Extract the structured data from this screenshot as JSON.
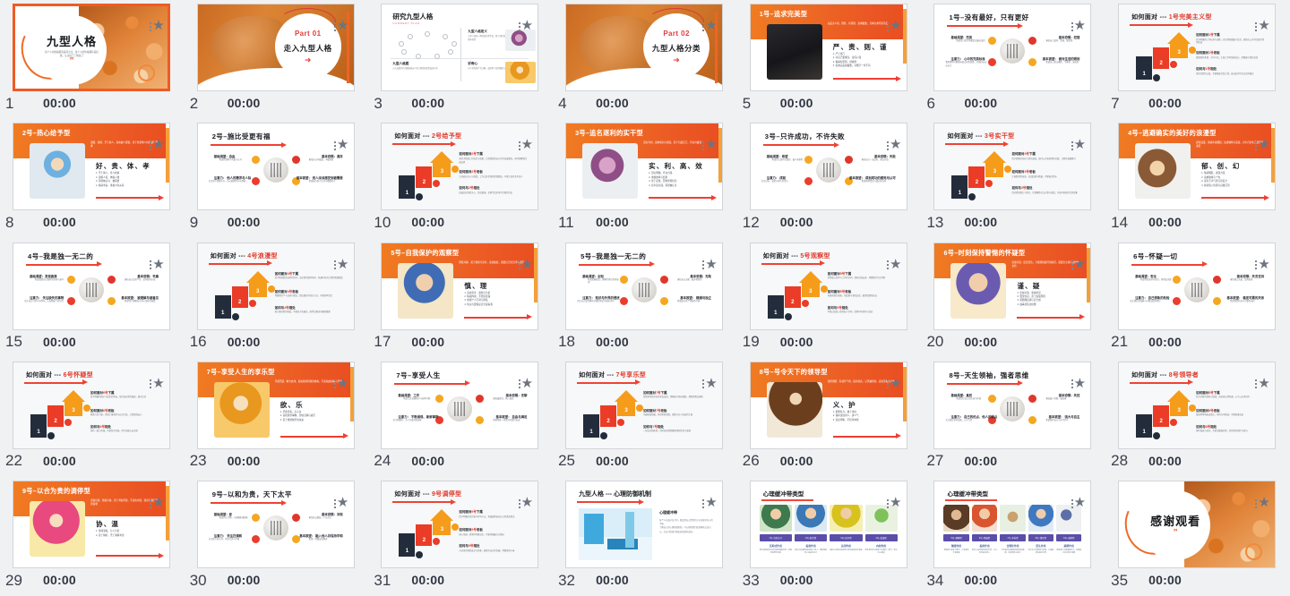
{
  "app": {
    "view": "slide-thumbnail-grid",
    "columns": 7,
    "rows": 5,
    "total_slides": 35,
    "selected_slide": 1,
    "accent_color": "#ef5b25",
    "background_color": "#f0f1f3",
    "star_icon": "star-icon",
    "default_time": "00:00"
  },
  "slides": [
    {
      "num": "1",
      "time": "00:00",
      "layout": "cover",
      "title": "九型人格",
      "subtitle": "每个人的性格都有其闪光点，每个人的性格都有其短板，认识自己了解自己",
      "quote": "”",
      "selected": true
    },
    {
      "num": "2",
      "time": "00:00",
      "layout": "part",
      "part_label": "Part 01",
      "title": "走入九型人格",
      "arrow": "➜"
    },
    {
      "num": "3",
      "time": "00:00",
      "layout": "overview",
      "title": "研究九型人格",
      "subtitle": "CURRENT PLAN",
      "blocks": [
        {
          "heading": "九型人格定义",
          "text": "九型人格是一种性格分类学说，把人的性格分为九种基本类型"
        },
        {
          "heading": "好奇心",
          "text": "对人的性格产生兴趣，去探索人性的奥秘与规律"
        },
        {
          "heading": "九型人格图",
          "text": "以九边形的几何图形表达人的九种性格类型及其关系"
        }
      ]
    },
    {
      "num": "4",
      "time": "00:00",
      "layout": "part",
      "part_label": "Part 02",
      "title": "九型人格分类",
      "arrow": "➜"
    },
    {
      "num": "5",
      "time": "00:00",
      "layout": "orange-header",
      "title": "1号–追求完美型",
      "header_desc": "完美主义者，理性、有原则、追求极致，凡事力求尽善尽美",
      "keywords": "严、责、则、谨",
      "lines": "1. 严于律己\n2. 对自己要求高，责任心强\n3. 做事有原则，讲规则\n4. 追求完美和极致，对细节一丝不苟",
      "photo": "ph-steve"
    },
    {
      "num": "6",
      "time": "00:00",
      "layout": "radial",
      "title": "1号–没有最好，只有更好",
      "nodes": [
        {
          "label": "基础渴望：完美",
          "text": "希望自己和世界都是正确无误的"
        },
        {
          "label": "注意力：\n心中的完美标准",
          "text": "看到事物与理想标准之间的差距，并想办法去纠正它"
        },
        {
          "label": "基本恐惧：犯错",
          "text": "害怕自己变坏、堕落、做错事"
        },
        {
          "label": "基本欲望：\n做对生活的规则",
          "text": "希望自己是正确的、平衡的、诚实的"
        }
      ]
    },
    {
      "num": "7",
      "time": "00:00",
      "layout": "stair",
      "title": "如何面对 --- ",
      "title_hl": "1号完美主义型",
      "steps": [
        {
          "n": "3",
          "heading": "如何面对",
          "heading_hl": "1号",
          "heading_tail": "下属",
          "text": "给予明确的工作标准与流程，肯定他的细致与负责，避免在公开场合批评他的错误"
        },
        {
          "n": "2",
          "heading": "如何面对",
          "heading_hl": "1号",
          "heading_tail": "老板",
          "text": "做事要有条理、守时守信，汇报工作时准备充分，用数据与事实说话"
        },
        {
          "n": "1",
          "heading": "如何与",
          "heading_hl": "1号",
          "heading_tail": "相处",
          "text": "多欣赏他的认真，不要随意打乱计划，表达批评时先肯定再建议"
        }
      ]
    },
    {
      "num": "8",
      "time": "00:00",
      "layout": "orange-header",
      "title": "2号–热心给予型",
      "header_desc": "温暖、热情、乐于助人，喜欢被人需要，善于察觉他人的情绪与需求",
      "keywords": "好、贵、体、孝",
      "lines": "1. 乐于助人，待人热情\n2. 善解人意，体贴入微\n3. 渴望被认可、被需要\n4. 情感丰富，重视人际关系",
      "photo": "ph-kid"
    },
    {
      "num": "9",
      "time": "00:00",
      "layout": "radial",
      "title": "2号–施比受更有福",
      "nodes": [
        {
          "label": "基础渴望：自由",
          "text": "希望得到他人的爱与认可"
        },
        {
          "label": "注意力：\n他人的需求与人际",
          "text": "关注别人需要什么，自己能提供什么帮助"
        },
        {
          "label": "基本恐惧：漠弃",
          "text": "害怕自己不被爱、不被需要"
        },
        {
          "label": "基本欲望：\n别人深深感受到被需要",
          "text": "希望成为别人生命中重要的人"
        }
      ]
    },
    {
      "num": "10",
      "time": "00:00",
      "layout": "stair",
      "title": "如何面对 --- ",
      "title_hl": "2号给予型",
      "steps": [
        {
          "n": "3",
          "heading": "如何面对",
          "heading_hl": "2号",
          "heading_tail": "下属",
          "text": "多给予情感上的肯定与感谢，让他感受到自己的付出被看见，同时提醒他注意边界"
        },
        {
          "n": "2",
          "heading": "如何面对",
          "heading_hl": "2号",
          "heading_tail": "老板",
          "text": "主动表达关心与感激，工作之外也保持情感联结，不要只谈任务不谈人"
        },
        {
          "n": "1",
          "heading": "如何与",
          "heading_hl": "2号",
          "heading_tail": "相处",
          "text": "真诚回应他的关心，常说谢谢，也要学会拒绝不合理的付出"
        }
      ]
    },
    {
      "num": "11",
      "time": "00:00",
      "layout": "orange-header",
      "title": "3号–追名逐利的实干型",
      "header_desc": "目标导向，追求成功与成就，善于包装自己，行动力极强",
      "keywords": "实、利、高、效",
      "lines": "1. 目标明确，行动力强\n2. 重视效率与结果\n3. 善于表现，形象管理出色\n4. 竞争意识强，渴望被认可",
      "photo": "ph-doer"
    },
    {
      "num": "12",
      "time": "00:00",
      "layout": "radial",
      "title": "3号–只许成功，不许失败",
      "nodes": [
        {
          "label": "基础渴望：希望",
          "text": "希望自己是有价值的、被人羡慕的"
        },
        {
          "label": "注意力：\n成就",
          "text": "关注目标、业绩与他人的评价"
        },
        {
          "label": "基本恐惧：失败",
          "text": "害怕自己一无是处、毫无价值"
        },
        {
          "label": "基本欲望：\n得到成功的感觉与认可",
          "text": "希望获得赞赏与成功的光环"
        }
      ]
    },
    {
      "num": "13",
      "time": "00:00",
      "layout": "stair",
      "title": "如何面对 --- ",
      "title_hl": "3号实干型",
      "steps": [
        {
          "n": "3",
          "heading": "如何面对",
          "heading_hl": "3号",
          "heading_tail": "下属",
          "text": "给予清晰的目标与晋升通道，及时公开表扬他的业绩，让他有施展舞台"
        },
        {
          "n": "2",
          "heading": "如何面对",
          "heading_hl": "3号",
          "heading_tail": "老板",
          "text": "汇报要简明高效，突出结果与数据，不要拖泥带水"
        },
        {
          "n": "1",
          "heading": "如何与",
          "heading_hl": "3号",
          "heading_tail": "相处",
          "text": "欣赏他的能力与努力，也提醒他关注过程与感受，不必时刻保持完美形象"
        }
      ]
    },
    {
      "num": "14",
      "time": "00:00",
      "layout": "orange-header",
      "title": "4号–逃避确实的美好的浪漫型",
      "header_desc": "感性浪漫，情感丰富细腻，追求独特与深度，对平凡的生活感到不满足",
      "keywords": "郁、创、幻",
      "lines": "1. 情感细腻，感受力强\n2. 追求独特与个性\n3. 富有艺术气质与创造力\n4. 容易陷入忧郁与自我沉溺",
      "photo": "ph-rom"
    },
    {
      "num": "15",
      "time": "00:00",
      "layout": "radial",
      "title": "4号–我是独一无二的",
      "nodes": [
        {
          "label": "基础渴望：发现真我",
          "text": "希望找到自己独特的身份与意义"
        },
        {
          "label": "注意力：\n关注缺失的事物",
          "text": "关注自己与别人的不同，以及所缺少的东西"
        },
        {
          "label": "基本恐惧：平庸",
          "text": "害怕自己没有个性、没有独特价值"
        },
        {
          "label": "基本欲望：\n被理解与被看见",
          "text": "希望别人理解自己内心深处的感受"
        }
      ]
    },
    {
      "num": "16",
      "time": "00:00",
      "layout": "stair",
      "title": "如何面对 --- ",
      "title_hl": "4号浪漫型",
      "steps": [
        {
          "n": "3",
          "heading": "如何面对",
          "heading_hl": "4号",
          "heading_tail": "下属",
          "text": "给予他创造性发挥的空间，肯定他的独特审美，沟通时多关注他的情绪感受"
        },
        {
          "n": "2",
          "heading": "如何面对",
          "heading_hl": "4号",
          "heading_tail": "老板",
          "text": "尊重他的个人品味与想法，提出建议时讲究方式，不要简单否定"
        },
        {
          "n": "1",
          "heading": "如何与",
          "heading_hl": "4号",
          "heading_tail": "相处",
          "text": "耐心倾听他的感受，不要急于给建议，陪伴比解决问题更重要"
        }
      ]
    },
    {
      "num": "17",
      "time": "00:00",
      "layout": "orange-header",
      "title": "5号–自我保护的观察型",
      "header_desc": "理性冷静、善于观察与思考，喜欢独处，需要自己的空间与能量",
      "keywords": "慎、理",
      "lines": "1. 喜欢思考、观察与分析\n2. 情感内敛，不轻易表露\n3. 重视个人空间与隐私\n4. 知识与逻辑是安全感来源",
      "photo": "ph-obs"
    },
    {
      "num": "18",
      "time": "00:00",
      "layout": "radial",
      "title": "5号–我是独一无二的",
      "nodes": [
        {
          "label": "基础渴望：全知",
          "text": "希望掌握知识，理解世界运作的规律"
        },
        {
          "label": "注意力：\n知识与外界的侵扰",
          "text": "关注自己是否拥有足够的知识与独处空间"
        },
        {
          "label": "基本恐惧：无助",
          "text": "害怕自己无能、被外界掏空"
        },
        {
          "label": "基本欲望：\n精通与独立",
          "text": "希望成为某个领域的专家"
        }
      ]
    },
    {
      "num": "19",
      "time": "00:00",
      "layout": "stair",
      "title": "如何面对 --- ",
      "title_hl": "5号观察型",
      "steps": [
        {
          "n": "3",
          "heading": "如何面对",
          "heading_hl": "5号",
          "heading_tail": "下属",
          "text": "给他独立思考与工作的空间，提前告知安排，尊重他的专业判断"
        },
        {
          "n": "2",
          "heading": "如何面对",
          "heading_hl": "5号",
          "heading_tail": "老板",
          "text": "沟通前做足准备，用逻辑与事实说话，避免情绪化表达"
        },
        {
          "n": "1",
          "heading": "如何与",
          "heading_hl": "5号",
          "heading_tail": "相处",
          "text": "不要过度侵入他的私人空间，给他时间消化与回应"
        }
      ]
    },
    {
      "num": "20",
      "time": "00:00",
      "layout": "orange-header",
      "title": "6号–时刻保持警惕的怀疑型",
      "header_desc": "忠诚可靠、居安思危，习惯预想最坏的情况，需要安全感与团体的支持",
      "keywords": "谨、疑",
      "lines": "1. 忠诚可靠，重视承诺\n2. 警觉性高，善于发现风险\n3. 需要确定感与安全感\n4. 遇事易焦虑犹豫",
      "photo": "ph-doubt"
    },
    {
      "num": "21",
      "time": "00:00",
      "layout": "radial",
      "title": "6号–怀疑一切",
      "nodes": [
        {
          "label": "基础渴望：安全",
          "text": "希望得到支持与指引，获得安全感"
        },
        {
          "label": "注意力：\n自己想象的危险",
          "text": "关注潜在的威胁与可能出错的地方"
        },
        {
          "label": "基本恐惧：失去支持",
          "text": "害怕孤立无援、没有依靠"
        },
        {
          "label": "基本欲望：\n稳定可靠的关系",
          "text": "希望得到信任与可靠的支持"
        }
      ]
    },
    {
      "num": "22",
      "time": "00:00",
      "layout": "stair",
      "title": "如何面对 --- ",
      "title_hl": "6号怀疑型",
      "steps": [
        {
          "n": "3",
          "heading": "如何面对",
          "heading_hl": "6号",
          "heading_tail": "下属",
          "text": "给予明确的指示与稳定的承诺，及时回应他的疑虑，建立信任"
        },
        {
          "n": "2",
          "heading": "如何面对",
          "heading_hl": "6号",
          "heading_tail": "老板",
          "text": "做事守信可靠，提前汇报风险与应对方案，让他感到安心"
        },
        {
          "n": "1",
          "heading": "如何与",
          "heading_hl": "6号",
          "heading_tail": "相处",
          "text": "保持一致与坦诚，不要忽冷忽热，用行动建立安全感"
        }
      ]
    },
    {
      "num": "23",
      "time": "00:00",
      "layout": "orange-header",
      "title": "7号–享受人生的享乐型",
      "header_desc": "乐观开朗、精力充沛，喜欢新鲜刺激的体验，不喜欢被束缚与限制",
      "keywords": "欲、乐",
      "lines": "1. 乐观活泼，点子多\n2. 喜欢新鲜事物，害怕无聊与痛苦\n3. 善于规划快乐的未来",
      "photo": "ph-joy"
    },
    {
      "num": "24",
      "time": "00:00",
      "layout": "radial",
      "title": "7号–享受人生",
      "nodes": [
        {
          "label": "基础渴望：工作",
          "text": "希望生活充满快乐与各种可能"
        },
        {
          "label": "注意力：\n不断涌现、新鲜事物",
          "text": "关注有趣的、令人兴奋的新选择"
        },
        {
          "label": "基本恐惧：无聊",
          "text": "害怕被困住、陷入痛苦"
        },
        {
          "label": "基本欲望：\n自由与满足",
          "text": "希望体验一切美好并保持自由"
        }
      ]
    },
    {
      "num": "25",
      "time": "00:00",
      "layout": "stair",
      "title": "如何面对 --- ",
      "title_hl": "7号享乐型",
      "steps": [
        {
          "n": "3",
          "heading": "如何面对",
          "heading_hl": "7号",
          "heading_tail": "下属",
          "text": "给他多样化的任务和自由度，用趣味与愿景激励，帮他把想法落地"
        },
        {
          "n": "2",
          "heading": "如何面对",
          "heading_hl": "7号",
          "heading_tail": "老板",
          "text": "沟通轻松积极，多提供新思路，避免冗长与负面的汇报"
        },
        {
          "n": "1",
          "heading": "如何与",
          "heading_hl": "7号",
          "heading_tail": "相处",
          "text": "一起尝试新体验，同时温和地提醒他承担责任与收尾"
        }
      ]
    },
    {
      "num": "26",
      "time": "00:00",
      "layout": "orange-header",
      "title": "8号–号令天下的领导型",
      "header_desc": "强势果断、有领导气场，保护弱者，讨厌被控制，喜欢掌握主动权",
      "keywords": "义、护",
      "lines": "1. 果断有力，敢于承担\n2. 保护身边的人，讲义气\n3. 直接坦率，不拐弯抹角",
      "photo": "ph-lead"
    },
    {
      "num": "27",
      "time": "00:00",
      "layout": "radial",
      "title": "8号–天生领袖，强者思维",
      "nodes": [
        {
          "label": "基础渴望：真权",
          "text": "希望掌控自己的命运与环境"
        },
        {
          "label": "注意力：\n自己的优点、他人的弱点",
          "text": "关注谁在掌控局面、公平与否"
        },
        {
          "label": "基本恐惧：失控",
          "text": "害怕被人控制、被伤害"
        },
        {
          "label": "基本欲望：\n强大与自主",
          "text": "希望保护自己与在乎的人"
        }
      ]
    },
    {
      "num": "28",
      "time": "00:00",
      "layout": "stair",
      "title": "如何面对 --- ",
      "title_hl": "8号领导者",
      "steps": [
        {
          "n": "3",
          "heading": "如何面对",
          "heading_hl": "8号",
          "heading_tail": "下属",
          "text": "给予足够的授权与挑战，直来直去地沟通，公平公正地对待"
        },
        {
          "n": "2",
          "heading": "如何面对",
          "heading_hl": "8号",
          "heading_tail": "老板",
          "text": "直接坦率地表达观点，有担当不推诿，不要唯唯诺诺"
        },
        {
          "n": "1",
          "heading": "如何与",
          "heading_hl": "8号",
          "heading_tail": "相处",
          "text": "保持真诚与坚定，不要试图操控他，欣赏他的保护与担当"
        }
      ]
    },
    {
      "num": "29",
      "time": "00:00",
      "layout": "orange-header",
      "title": "9号–以合为贵的调停型",
      "header_desc": "温和包容、随和平静，善于调和矛盾，不喜欢冲突，容易忽略自己的需求",
      "keywords": "协、温",
      "lines": "1. 性情温和，与人为善\n2. 善于倾听，乐于调解冲突",
      "photo": "ph-peace"
    },
    {
      "num": "30",
      "time": "00:00",
      "layout": "radial",
      "title": "9号–以和为贵，天下太平",
      "nodes": [
        {
          "label": "基础渴望：爱",
          "text": "希望内心平静，与周围和谐相处"
        },
        {
          "label": "注意力：\n关注在调和",
          "text": "关注他人的立场，寻求共识与平衡"
        },
        {
          "label": "基本恐惧：冲突",
          "text": "害怕失去联结、产生对立"
        },
        {
          "label": "基本欲望：\n融入他人并保持平和",
          "text": "希望一切都安稳顺遂"
        }
      ]
    },
    {
      "num": "31",
      "time": "00:00",
      "layout": "stair",
      "title": "如何面对 --- ",
      "title_hl": "9号调停型",
      "steps": [
        {
          "n": "3",
          "heading": "如何面对",
          "heading_hl": "9号",
          "heading_tail": "下属",
          "text": "给予明确的优先级与时间节点，多鼓励他表达自己的真实想法"
        },
        {
          "n": "2",
          "heading": "如何面对",
          "heading_hl": "9号",
          "heading_tail": "老板",
          "text": "耐心沟通，给他时间做决定，不要用强硬方式施压"
        },
        {
          "n": "1",
          "heading": "如何与",
          "heading_hl": "9号",
          "heading_tail": "相处",
          "text": "主动询问他的意见与需要，避免冲突式的沟通，尊重他的节奏"
        }
      ]
    },
    {
      "num": "32",
      "time": "00:00",
      "layout": "psych",
      "title": "九型人格 --- 心理防御机制",
      "heading": "心理缓冲带",
      "text": "每个人在面对压力时，都会用自己惯用的方式来保护内心的平衡。\n\n了解自己的心理防御机制，可以帮助我们更清晰地认识自己，在压力情境中做出更成熟的选择。"
    },
    {
      "num": "33",
      "time": "00:00",
      "layout": "buffer",
      "title": "心理缓冲带类型",
      "items": [
        {
          "tag": "1号–完美主义",
          "cap": "压抑式作用",
          "text": "把不被接受的冲动压抑到潜意识里，表面显得理性克制",
          "icon": "bufA1"
        },
        {
          "tag": "2号–助力型",
          "cap": "投射作用",
          "text": "把自己的需要投射到别人身上，借助帮助他人来满足自己",
          "icon": "bufA2"
        },
        {
          "tag": "3号–实干型",
          "cap": "认同作用",
          "text": "通过认同成功的形象与角色来获得价值感",
          "icon": "bufA3"
        },
        {
          "tag": "4号–浪漫型",
          "cap": "内射作用",
          "text": "把外界的评价吸收为自我的一部分，放大内心感受",
          "icon": "bufA4"
        }
      ]
    },
    {
      "num": "34",
      "time": "00:00",
      "layout": "buffer",
      "title": "心理缓冲带类型",
      "items": [
        {
          "tag": "5号–观察型",
          "cap": "隔离作用",
          "text": "把情感与事件分离开，只谈事实不谈感受",
          "icon": "bufB1"
        },
        {
          "tag": "6号–怀疑型",
          "cap": "投射作用",
          "text": "把内心的恐惧投射到外界，认为危险来自他人",
          "icon": "bufB2"
        },
        {
          "tag": "7号–享乐型",
          "cap": "合理化作用",
          "text": "为不愉快的事情找到积极的解释，快速转移注意力",
          "icon": "bufB3"
        },
        {
          "tag": "8号–领导型",
          "cap": "否认作用",
          "text": "否认自己的脆弱与伤痛，以强硬姿态面对外界",
          "icon": "bufB4"
        },
        {
          "tag": "9号–调停型",
          "cap": "麻醉作用",
          "text": "用琐事与习惯麻痹自己，回避真正的冲突与需要",
          "icon": "bufB5"
        }
      ]
    },
    {
      "num": "35",
      "time": "00:00",
      "layout": "cover",
      "title": "感谢观看",
      "subtitle": "",
      "quote": "”",
      "selected": false
    }
  ]
}
